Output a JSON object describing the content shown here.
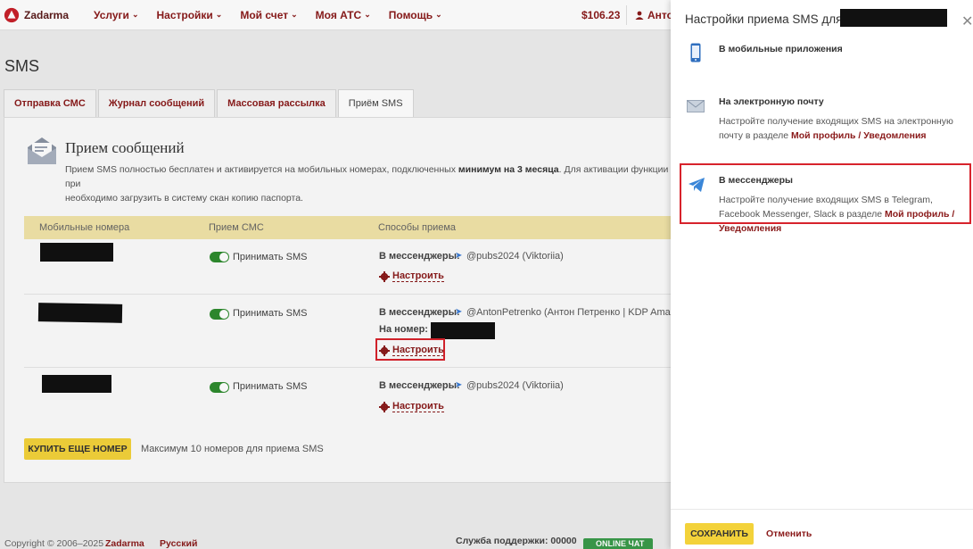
{
  "app": {
    "brand": "Zadarma"
  },
  "nav": {
    "menu": [
      {
        "label": "Услуги"
      },
      {
        "label": "Настройки"
      },
      {
        "label": "Мой счет"
      },
      {
        "label": "Моя АТС"
      },
      {
        "label": "Помощь"
      }
    ],
    "balance": "$106.23",
    "user": "Анто"
  },
  "page": {
    "title": "SMS"
  },
  "tabs": [
    {
      "label": "Отправка СМС"
    },
    {
      "label": "Журнал сообщений"
    },
    {
      "label": "Массовая рассылка"
    },
    {
      "label": "Приём SMS"
    }
  ],
  "card": {
    "title": "Прием сообщений",
    "desc_pre": "Прием SMS полностью бесплатен и активируется на мобильных номерах, подключенных ",
    "desc_bold": "минимум на 3 месяца",
    "desc_post": ". Для активации функции при",
    "desc_line2": "необходимо загрузить в систему скан копию паспорта."
  },
  "table": {
    "headers": [
      "Мобильные номера",
      "Прием СМС",
      "Способы приема"
    ],
    "rows": [
      {
        "accept_label": "Принимать SMS",
        "messenger_label": "В мессенджеры:",
        "messenger_value": "@pubs2024 (Viktoriia)",
        "configure": "Настроить"
      },
      {
        "accept_label": "Принимать SMS",
        "messenger_label": "В мессенджеры:",
        "messenger_value": "@AntonPetrenko (Антон Петренко | KDP Amazon",
        "number_label": "На номер: +",
        "configure": "Настроить"
      },
      {
        "accept_label": "Принимать SMS",
        "messenger_label": "В мессенджеры:",
        "messenger_value": "@pubs2024 (Viktoriia)",
        "configure": "Настроить"
      }
    ]
  },
  "buy": {
    "button": "КУПИТЬ ЕЩЕ НОМЕР",
    "note": "Максимум 10 номеров для приема SMS"
  },
  "footer": {
    "copyright": "Copyright © 2006–2025",
    "brand": "Zadarma",
    "language": "Русский",
    "support": "Служба поддержки: 00000",
    "online_chat": "ONLINE ЧАТ"
  },
  "panel": {
    "title": "Настройки приема SMS для",
    "options": [
      {
        "title": "В мобильные приложения",
        "icon": "phone-icon"
      },
      {
        "title": "На электронную почту",
        "icon": "envelope-icon",
        "desc": "Настройте получение входящих SMS на электронную почту в разделе ",
        "link": "Мой профиль / Уведомления"
      },
      {
        "title": "В мессенджеры",
        "icon": "telegram-icon",
        "desc": "Настройте получение входящих SMS в Telegram, Facebook Messenger, Slack в разделе ",
        "link": "Мой профиль / Уведомления"
      }
    ],
    "save": "СОХРАНИТЬ",
    "cancel": "Отменить"
  },
  "colors": {
    "brand": "#8a1a1a",
    "accent_yellow": "#f3d23a",
    "highlight": "#d7232c",
    "toggle_on": "#2e8b2e"
  }
}
